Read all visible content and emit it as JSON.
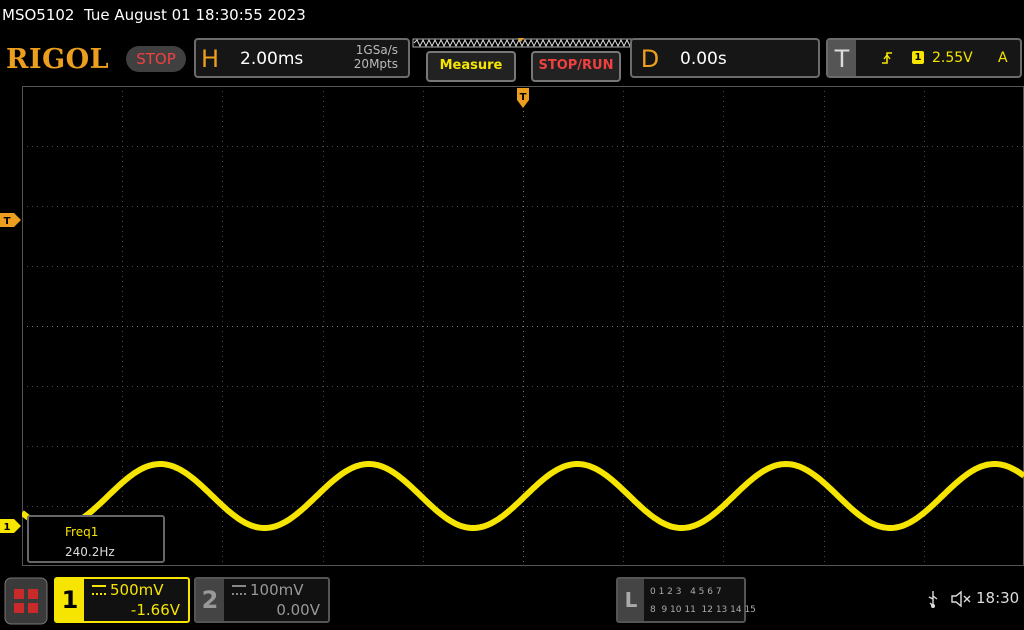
{
  "title": "MSO5102  Tue August 01 18:30:55 2023",
  "logo": "RIGOL",
  "run_state": "STOP",
  "horizontal": {
    "letter": "H",
    "timebase": "2.00ms",
    "sample_rate": "1GSa/s",
    "memory": "20Mpts"
  },
  "buttons": {
    "measure": "Measure",
    "stop_run": "STOP/RUN"
  },
  "delay": {
    "letter": "D",
    "value": "0.00s"
  },
  "trigger": {
    "letter": "T",
    "source": "1",
    "level": "2.55V",
    "mode": "A",
    "marker": "T"
  },
  "channel1": {
    "number": "1",
    "scale": "500mV",
    "offset": "-1.66V",
    "marker": "1",
    "color": "#f5e500"
  },
  "channel2": {
    "number": "2",
    "scale": "100mV",
    "offset": "0.00V"
  },
  "measurement": {
    "label": "Freq1",
    "value": "240.2Hz"
  },
  "logic": {
    "letter": "L",
    "row1": "0 1 2 3   4 5 6 7",
    "row2": "8  9 10 11  12 13 14 15"
  },
  "status": {
    "time": "18:30"
  },
  "colors": {
    "accent": "#ec9f1f",
    "trace": "#f5e500",
    "stop": "#f04040",
    "grid": "#5a5a5a"
  },
  "icons": [
    "menu-icon",
    "usb-icon",
    "speaker-muted-icon",
    "trigger-edge-icon"
  ]
}
